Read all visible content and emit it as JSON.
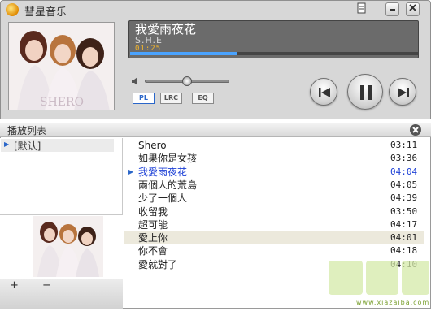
{
  "app": {
    "title": "彗星音乐"
  },
  "now_playing": {
    "title": "我愛雨夜花",
    "artist": "S.H.E",
    "time": "01:25",
    "progress": 0.37,
    "volume": 0.5
  },
  "modes": [
    {
      "label": "PL",
      "active": true
    },
    {
      "label": "LRC",
      "active": false
    },
    {
      "label": "EQ",
      "active": false
    }
  ],
  "album_caption": "SHERO",
  "playlist": {
    "title": "播放列表",
    "group": "[默认]",
    "tracks": [
      {
        "name": "Shero",
        "duration": "03:11"
      },
      {
        "name": "如果你是女孩",
        "duration": "03:36"
      },
      {
        "name": "我愛雨夜花",
        "duration": "04:04"
      },
      {
        "name": "兩個人的荒島",
        "duration": "04:05"
      },
      {
        "name": "少了一個人",
        "duration": "04:39"
      },
      {
        "name": "收留我",
        "duration": "03:50"
      },
      {
        "name": "超可能",
        "duration": "04:17"
      },
      {
        "name": "愛上你",
        "duration": "04:01"
      },
      {
        "name": "你不會",
        "duration": "04:18"
      },
      {
        "name": "愛就對了",
        "duration": "04:10"
      }
    ],
    "playing_index": 2,
    "selected_index": 7
  },
  "footer": {
    "add": "+",
    "remove": "−"
  },
  "watermark": {
    "text": "www.xiazaiba.com"
  },
  "colors": {
    "accent": "#2a66c9",
    "playing": "#1c3fd6",
    "lcd": "#6b6b6b",
    "time": "#f5b62a"
  }
}
